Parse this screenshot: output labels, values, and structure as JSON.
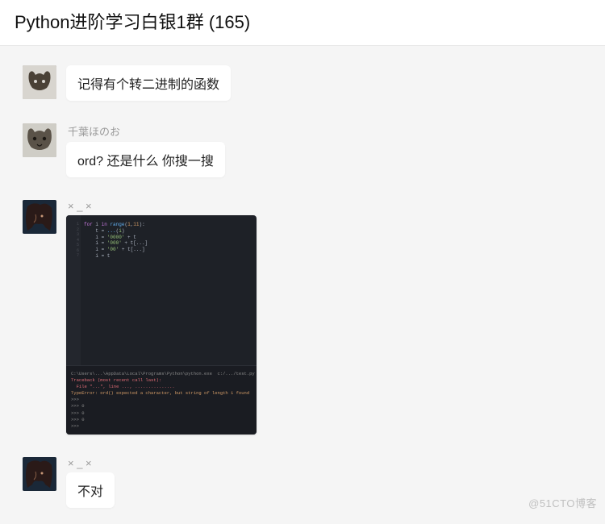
{
  "header": {
    "title": "Python进阶学习白银1群 (165)"
  },
  "messages": [
    {
      "avatar": "cat1",
      "nickname": "",
      "text": "记得有个转二进制的函数"
    },
    {
      "avatar": "cat2",
      "nickname": "千葉ほのお",
      "text": "ord?  还是什么  你搜一搜"
    },
    {
      "avatar": "anime",
      "nickname": "× _ ×",
      "image": true
    },
    {
      "avatar": "anime",
      "nickname": "× _ ×",
      "text": "不对"
    }
  ],
  "code_image": {
    "code_lines": [
      "for i in range(1,11):",
      "    t = ............(i)",
      "    i = '0000' + t",
      "    i = '000' + t[...]",
      "    i = '00' + t[...]",
      "    i = t"
    ],
    "terminal_lines": [
      {
        "cls": "",
        "text": "C:\\Users\\...\\AppData\\Local\\Programs\\Python\\python.exe  c:/.../test.py"
      },
      {
        "cls": "err",
        "text": "Traceback (most recent call last):"
      },
      {
        "cls": "err",
        "text": "  File \"...\", line ..., ..............."
      },
      {
        "cls": "err2",
        "text": "TypeError: ord() expected a character, but string of length 1 found"
      },
      {
        "cls": "",
        "text": ">>> "
      },
      {
        "cls": "",
        "text": ">>> 0"
      },
      {
        "cls": "",
        "text": ">>> 0"
      },
      {
        "cls": "",
        "text": ">>> 0"
      },
      {
        "cls": "",
        "text": ">>> "
      }
    ]
  },
  "watermark": "@51CTO博客"
}
